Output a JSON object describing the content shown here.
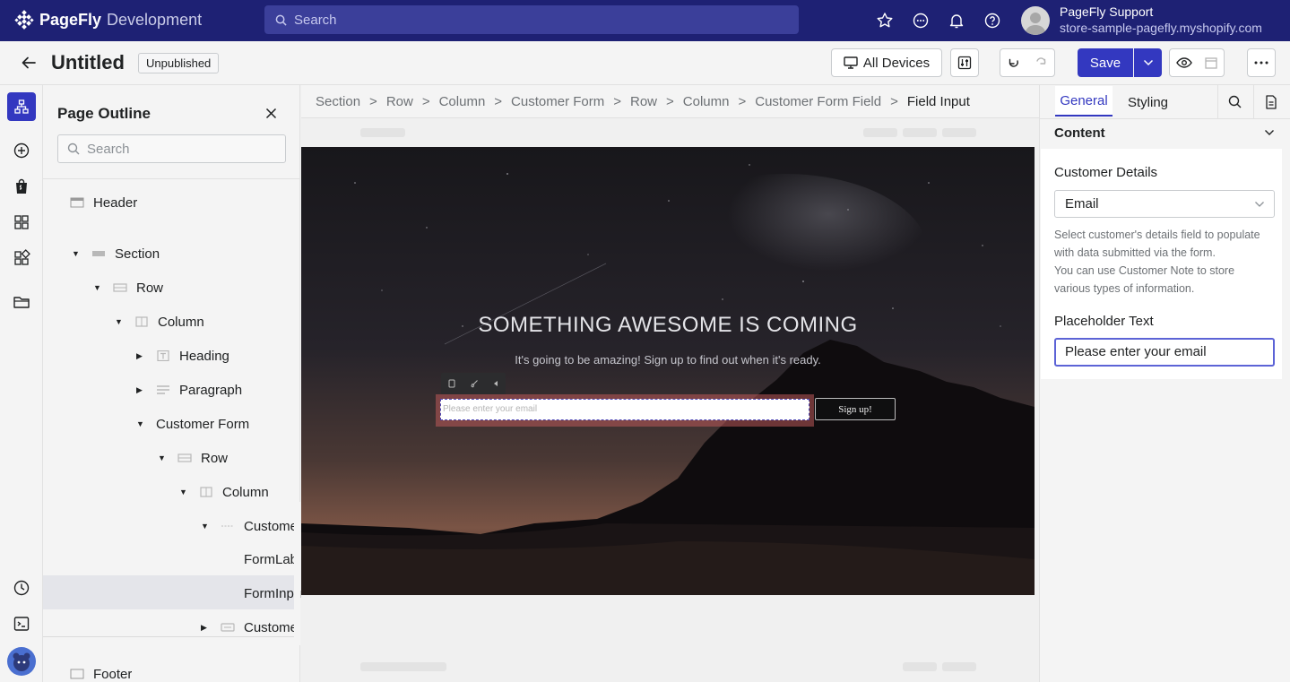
{
  "topbar": {
    "brand_name": "PageFly",
    "brand_suffix": "Development",
    "search_placeholder": "Search",
    "user_name": "PageFly Support",
    "store_url": "store-sample-pagefly.myshopify.com",
    "icons": [
      "star-icon",
      "chat-icon",
      "bell-icon",
      "help-icon"
    ]
  },
  "titlebar": {
    "title": "Untitled",
    "status": "Unpublished",
    "device_label": "All Devices",
    "save_label": "Save"
  },
  "outline": {
    "title": "Page Outline",
    "search_placeholder": "Search",
    "items": [
      {
        "label": "Header"
      },
      {
        "label": "Section"
      },
      {
        "label": "Row"
      },
      {
        "label": "Column"
      },
      {
        "label": "Heading"
      },
      {
        "label": "Paragraph"
      },
      {
        "label": "Customer Form"
      },
      {
        "label": "Row"
      },
      {
        "label": "Column"
      },
      {
        "label": "Custome"
      },
      {
        "label": "FormLab"
      },
      {
        "label": "FormInpu"
      },
      {
        "label": "Custome"
      },
      {
        "label": "Footer"
      }
    ]
  },
  "breadcrumb": [
    "Section",
    "Row",
    "Column",
    "Customer Form",
    "Row",
    "Column",
    "Customer Form Field",
    "Field Input"
  ],
  "canvas": {
    "hero_title": "SOMETHING AWESOME IS COMING",
    "hero_subtitle": "It's going to be amazing! Sign up to find out when it's ready.",
    "email_placeholder": "Please enter your email",
    "signup_label": "Sign up!"
  },
  "settings": {
    "tab_general": "General",
    "tab_styling": "Styling",
    "section_title": "Content",
    "customer_details_label": "Customer Details",
    "customer_details_value": "Email",
    "help_line1": "Select customer's details field to populate",
    "help_line2": "with data submitted via the form.",
    "help_line3": "You can use Customer Note to store",
    "help_line4": "various types of information.",
    "placeholder_label": "Placeholder Text",
    "placeholder_value": "Please enter your email"
  },
  "colors": {
    "topbar": "#1e2174",
    "accent": "#3338c0"
  }
}
